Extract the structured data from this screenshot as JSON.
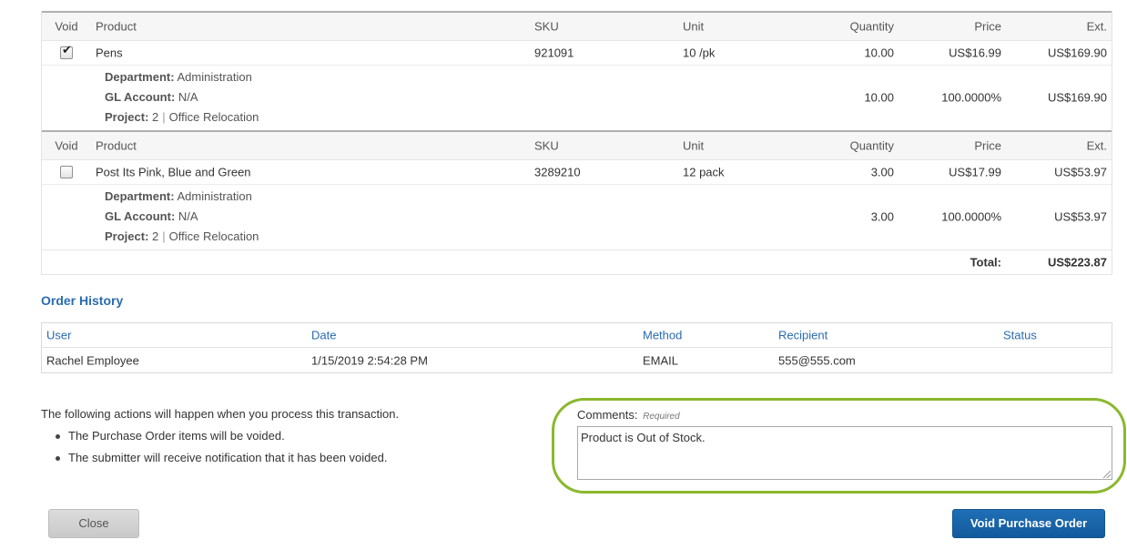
{
  "table_headers": {
    "void": "Void",
    "product": "Product",
    "sku": "SKU",
    "unit": "Unit",
    "quantity": "Quantity",
    "price": "Price",
    "ext": "Ext."
  },
  "items": [
    {
      "voided": true,
      "product": "Pens",
      "sku": "921091",
      "unit": "10 /pk",
      "quantity": "10.00",
      "price": "US$16.99",
      "ext": "US$169.90",
      "department_label": "Department:",
      "department": "Administration",
      "gl_label": "GL Account:",
      "gl": "N/A",
      "project_label": "Project:",
      "project_num": "2",
      "project_name": "Office Relocation",
      "alloc_qty": "10.00",
      "alloc_pct": "100.0000%",
      "alloc_ext": "US$169.90"
    },
    {
      "voided": false,
      "product": "Post Its Pink, Blue and Green",
      "sku": "3289210",
      "unit": "12 pack",
      "quantity": "3.00",
      "price": "US$17.99",
      "ext": "US$53.97",
      "department_label": "Department:",
      "department": "Administration",
      "gl_label": "GL Account:",
      "gl": "N/A",
      "project_label": "Project:",
      "project_num": "2",
      "project_name": "Office Relocation",
      "alloc_qty": "3.00",
      "alloc_pct": "100.0000%",
      "alloc_ext": "US$53.97"
    }
  ],
  "total": {
    "label": "Total:",
    "value": "US$223.87"
  },
  "order_history": {
    "title": "Order History",
    "headers": {
      "user": "User",
      "date": "Date",
      "method": "Method",
      "recipient": "Recipient",
      "status": "Status"
    },
    "rows": [
      {
        "user": "Rachel Employee",
        "date": "1/15/2019 2:54:28 PM",
        "method": "EMAIL",
        "recipient": "555@555.com",
        "status": ""
      }
    ]
  },
  "actions": {
    "intro": "The following actions will happen when you process this transaction.",
    "bullets": [
      "The Purchase Order items will be voided.",
      "The submitter will receive notification that it has been voided."
    ]
  },
  "comments": {
    "label": "Comments:",
    "required": "Required",
    "value": "Product is Out of Stock."
  },
  "buttons": {
    "close": "Close",
    "void": "Void Purchase Order"
  },
  "colors": {
    "accent": "#2a6bb0",
    "highlight_oval": "#8bb82d",
    "primary_button": "#1a64a8"
  }
}
